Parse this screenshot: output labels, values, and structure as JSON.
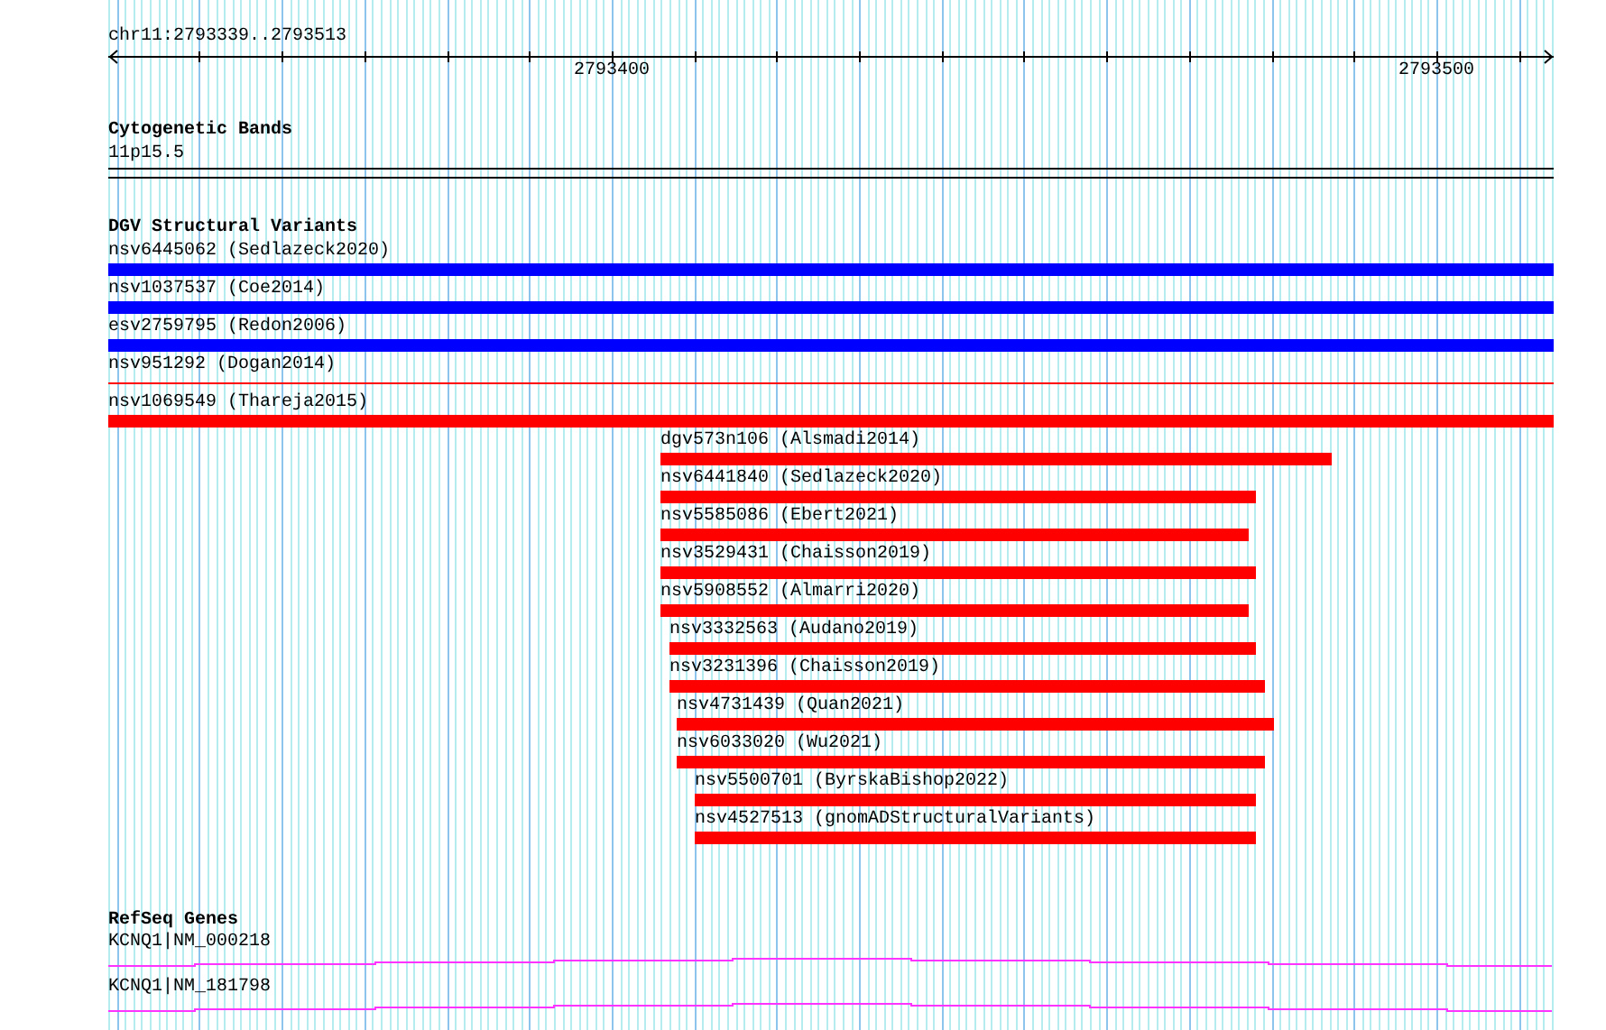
{
  "ruler": {
    "position": "chr11:2793339..2793513",
    "tick_labels": [
      "2793400",
      "2793500"
    ]
  },
  "tracks": [
    {
      "kind": "bands",
      "title": "Cytogenetic Bands",
      "items": [
        {
          "label": "11p15.5"
        }
      ]
    },
    {
      "kind": "variants",
      "title": "DGV Structural Variants",
      "items": [
        {
          "label": "nsv6445062 (Sedlazeck2020)",
          "color": "#0000ff",
          "kind": "bar"
        },
        {
          "label": "nsv1037537 (Coe2014)",
          "color": "#0000ff",
          "kind": "bar"
        },
        {
          "label": "esv2759795 (Redon2006)",
          "color": "#0000ff",
          "kind": "bar"
        },
        {
          "label": "nsv951292 (Dogan2014)",
          "color": "#ff0000",
          "kind": "line"
        },
        {
          "label": "nsv1069549 (Thareja2015)",
          "color": "#ff0000",
          "kind": "bar"
        },
        {
          "label": "dgv573n106 (Alsmadi2014)",
          "color": "#ff0000",
          "kind": "bar"
        },
        {
          "label": "nsv6441840 (Sedlazeck2020)",
          "color": "#ff0000",
          "kind": "bar"
        },
        {
          "label": "nsv5585086 (Ebert2021)",
          "color": "#ff0000",
          "kind": "bar"
        },
        {
          "label": "nsv3529431 (Chaisson2019)",
          "color": "#ff0000",
          "kind": "bar"
        },
        {
          "label": "nsv5908552 (Almarri2020)",
          "color": "#ff0000",
          "kind": "bar"
        },
        {
          "label": "nsv3332563 (Audano2019)",
          "color": "#ff0000",
          "kind": "bar"
        },
        {
          "label": "nsv3231396 (Chaisson2019)",
          "color": "#ff0000",
          "kind": "bar"
        },
        {
          "label": "nsv4731439 (Quan2021)",
          "color": "#ff0000",
          "kind": "bar"
        },
        {
          "label": "nsv6033020 (Wu2021)",
          "color": "#ff0000",
          "kind": "bar"
        },
        {
          "label": "nsv5500701 (ByrskaBishop2022)",
          "color": "#ff0000",
          "kind": "bar"
        },
        {
          "label": "nsv4527513 (gnomADStructuralVariants)",
          "color": "#ff0000",
          "kind": "bar"
        }
      ]
    },
    {
      "kind": "genes",
      "title": "RefSeq Genes",
      "items": [
        {
          "label": "KCNQ1|NM_000218"
        },
        {
          "label": "KCNQ1|NM_181798"
        }
      ]
    }
  ]
}
